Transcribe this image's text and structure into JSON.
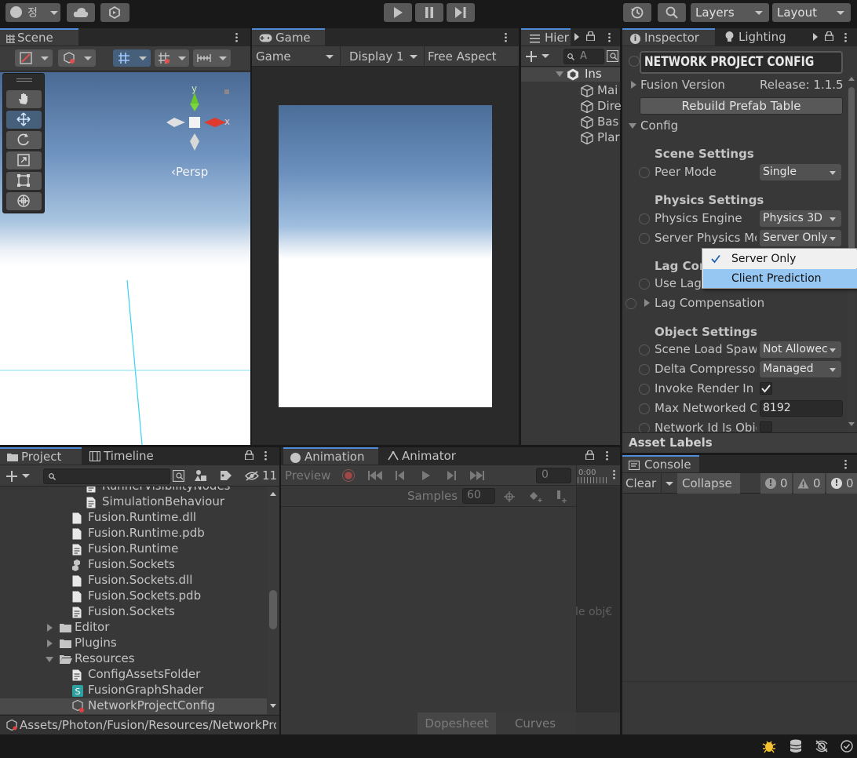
{
  "toolbar": {
    "account_label": "정",
    "layers_label": "Layers",
    "layout_label": "Layout"
  },
  "scene": {
    "tab_label": "Scene",
    "gizmo_y": "y",
    "gizmo_x": "x",
    "persp_label": "‹Persp"
  },
  "game": {
    "tab_label": "Game",
    "mode_select": "Game",
    "display_select": "Display 1",
    "aspect_select": "Free Aspect"
  },
  "hierarchy": {
    "tab_label": "Hier",
    "search_placeholder": "A",
    "scene_name": "Ins",
    "items": [
      "Mai",
      "Dire",
      "Bas",
      "Plar"
    ]
  },
  "inspector": {
    "tab_label": "Inspector",
    "lighting_tab_label": "Lighting",
    "title": "NETWORK PROJECT CONFIG",
    "fusion_version_label": "Fusion Version",
    "fusion_version_value": "Release: 1.1.5.",
    "rebuild_button": "Rebuild Prefab Table",
    "config_label": "Config",
    "scene_settings_header": "Scene Settings",
    "peer_mode_label": "Peer Mode",
    "peer_mode_value": "Single",
    "physics_settings_header": "Physics Settings",
    "physics_engine_label": "Physics Engine",
    "physics_engine_value": "Physics 3D",
    "server_physics_label": "Server Physics Mc",
    "server_physics_value": "Server Only",
    "lag_comp_header": "Lag Com",
    "use_lag_label": "Use Lag",
    "lag_compensation_label": "Lag Compensation",
    "object_settings_header": "Object Settings",
    "scene_load_label": "Scene Load Spaw",
    "scene_load_value": "Not Allowec",
    "delta_compressor_label": "Delta Compressor",
    "delta_compressor_value": "Managed",
    "invoke_render_label": "Invoke Render In E",
    "max_networked_label": "Max Networked O",
    "max_networked_value": "8192",
    "network_id_label": "Network Id Is Obie",
    "asset_labels": "Asset Labels"
  },
  "popup": {
    "options": [
      "Server Only",
      "Client Prediction"
    ],
    "checked_index": 0,
    "highlighted_index": 1
  },
  "project": {
    "tab_label": "Project",
    "timeline_tab_label": "Timeline",
    "hidden_count": "11",
    "items": [
      "RunnerVisibilityNodes",
      "SimulationBehaviour",
      "Fusion.Runtime.dll",
      "Fusion.Runtime.pdb",
      "Fusion.Runtime",
      "Fusion.Sockets",
      "Fusion.Sockets.dll",
      "Fusion.Sockets.pdb",
      "Fusion.Sockets",
      "Editor",
      "Plugins",
      "Resources",
      "ConfigAssetsFolder",
      "FusionGraphShader",
      "NetworkProjectConfig"
    ],
    "path": "Assets/Photon/Fusion/Resources/NetworkPro"
  },
  "animation": {
    "tab_label": "Animation",
    "animator_tab_label": "Animator",
    "preview_label": "Preview",
    "frame_value": "0",
    "samples_label": "Samples",
    "samples_value": "60",
    "timeline_ruler": "0:00",
    "empty_hint": "le obj€",
    "dopesheet_label": "Dopesheet",
    "curves_label": "Curves"
  },
  "console": {
    "tab_label": "Console",
    "clear_label": "Clear",
    "collapse_label": "Collapse",
    "log_count": "0",
    "warn_count": "0",
    "error_count": "0"
  },
  "colors": {
    "accent": "#4f8bd6",
    "highlight": "#96c6f2",
    "panel": "#383838"
  }
}
